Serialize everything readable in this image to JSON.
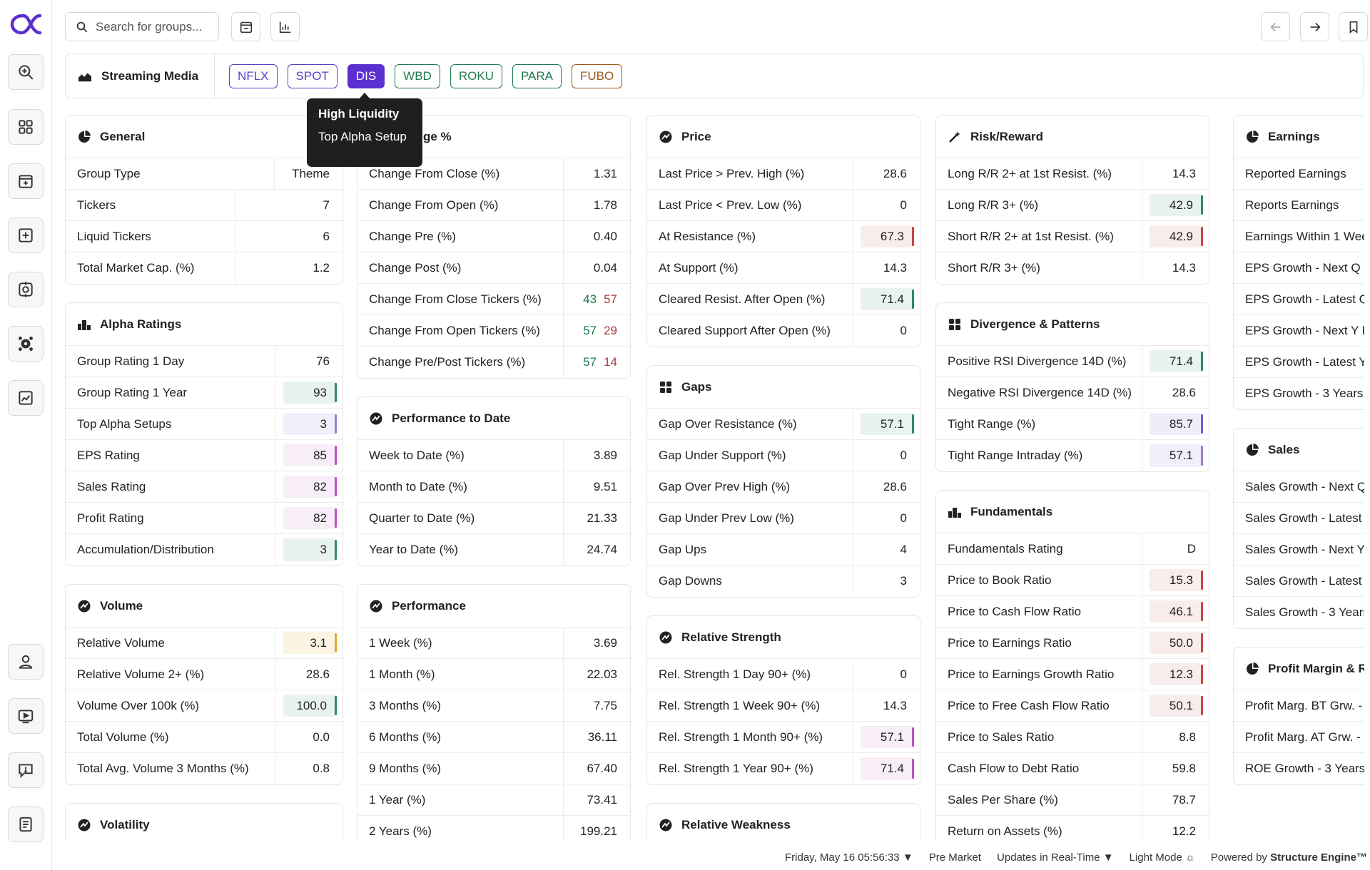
{
  "search": {
    "placeholder": "Search for groups..."
  },
  "group": {
    "name": "Streaming Media",
    "tickers": [
      {
        "label": "NFLX",
        "color": "#5b3fc4"
      },
      {
        "label": "SPOT",
        "color": "#5b3fc4"
      },
      {
        "label": "DIS",
        "color": "#ffffff",
        "active": true,
        "bg": "#5b2fd0"
      },
      {
        "label": "WBD",
        "color": "#1f7a4f"
      },
      {
        "label": "ROKU",
        "color": "#1f7a4f"
      },
      {
        "label": "PARA",
        "color": "#1f7a4f"
      },
      {
        "label": "FUBO",
        "color": "#9a5a1a"
      }
    ]
  },
  "tooltip": {
    "line1": "High Liquidity",
    "line2": "Top Alpha Setup"
  },
  "cards": {
    "general": {
      "title": "General",
      "rows": [
        {
          "label": "Group Type",
          "value": "Theme"
        },
        {
          "label": "Tickers",
          "value": "7"
        },
        {
          "label": "Liquid Tickers",
          "value": "6"
        },
        {
          "label": "Total Market Cap. (%)",
          "value": "1.2"
        }
      ]
    },
    "alpha": {
      "title": "Alpha Ratings",
      "rows": [
        {
          "label": "Group Rating 1 Day",
          "value": "76"
        },
        {
          "label": "Group Rating 1 Year",
          "value": "93"
        },
        {
          "label": "Top Alpha Setups",
          "value": "3"
        },
        {
          "label": "EPS Rating",
          "value": "85"
        },
        {
          "label": "Sales Rating",
          "value": "82"
        },
        {
          "label": "Profit Rating",
          "value": "82"
        },
        {
          "label": "Accumulation/Distribution",
          "value": "3"
        }
      ]
    },
    "volume": {
      "title": "Volume",
      "rows": [
        {
          "label": "Relative Volume",
          "value": "3.1"
        },
        {
          "label": "Relative Volume 2+ (%)",
          "value": "28.6"
        },
        {
          "label": "Volume Over 100k (%)",
          "value": "100.0"
        },
        {
          "label": "Total Volume (%)",
          "value": "0.0"
        },
        {
          "label": "Total Avg. Volume 3 Months (%)",
          "value": "0.8"
        }
      ]
    },
    "volatility": {
      "title": "Volatility"
    },
    "change": {
      "title_suffix": "ge %",
      "rows": [
        {
          "label": "Change From Close (%)",
          "value": "1.31"
        },
        {
          "label": "Change From Open (%)",
          "value": "1.78"
        },
        {
          "label": "Change Pre (%)",
          "value": "0.40"
        },
        {
          "label": "Change Post (%)",
          "value": "0.04"
        },
        {
          "label": "Change From Close Tickers (%)",
          "value_a": "43",
          "value_b": "57"
        },
        {
          "label": "Change From Open Tickers (%)",
          "value_a": "57",
          "value_b": "29"
        },
        {
          "label": "Change Pre/Post Tickers (%)",
          "value_a": "57",
          "value_b": "14"
        }
      ]
    },
    "perf_date": {
      "title": "Performance to Date",
      "rows": [
        {
          "label": "Week to Date (%)",
          "value": "3.89"
        },
        {
          "label": "Month to Date (%)",
          "value": "9.51"
        },
        {
          "label": "Quarter to Date (%)",
          "value": "21.33"
        },
        {
          "label": "Year to Date (%)",
          "value": "24.74"
        }
      ]
    },
    "performance": {
      "title": "Performance",
      "rows": [
        {
          "label": "1 Week (%)",
          "value": "3.69"
        },
        {
          "label": "1 Month (%)",
          "value": "22.03"
        },
        {
          "label": "3 Months (%)",
          "value": "7.75"
        },
        {
          "label": "6 Months (%)",
          "value": "36.11"
        },
        {
          "label": "9 Months (%)",
          "value": "67.40"
        },
        {
          "label": "1 Year (%)",
          "value": "73.41"
        },
        {
          "label": "2 Years (%)",
          "value": "199.21"
        }
      ]
    },
    "price": {
      "title": "Price",
      "rows": [
        {
          "label": "Last Price > Prev. High (%)",
          "value": "28.6"
        },
        {
          "label": "Last Price < Prev. Low (%)",
          "value": "0"
        },
        {
          "label": "At Resistance (%)",
          "value": "67.3"
        },
        {
          "label": "At Support (%)",
          "value": "14.3"
        },
        {
          "label": "Cleared Resist. After Open (%)",
          "value": "71.4"
        },
        {
          "label": "Cleared Support After Open (%)",
          "value": "0"
        }
      ]
    },
    "gaps": {
      "title": "Gaps",
      "rows": [
        {
          "label": "Gap Over Resistance (%)",
          "value": "57.1"
        },
        {
          "label": "Gap Under Support (%)",
          "value": "0"
        },
        {
          "label": "Gap Over Prev High (%)",
          "value": "28.6"
        },
        {
          "label": "Gap Under Prev Low (%)",
          "value": "0"
        },
        {
          "label": "Gap Ups",
          "value": "4"
        },
        {
          "label": "Gap Downs",
          "value": "3"
        }
      ]
    },
    "rel_strength": {
      "title": "Relative Strength",
      "rows": [
        {
          "label": "Rel. Strength 1 Day 90+ (%)",
          "value": "0"
        },
        {
          "label": "Rel. Strength 1 Week 90+ (%)",
          "value": "14.3"
        },
        {
          "label": "Rel. Strength 1 Month 90+ (%)",
          "value": "57.1"
        },
        {
          "label": "Rel. Strength 1 Year 90+ (%)",
          "value": "71.4"
        }
      ]
    },
    "rel_weakness": {
      "title": "Relative Weakness"
    },
    "risk": {
      "title": "Risk/Reward",
      "rows": [
        {
          "label": "Long R/R 2+ at 1st Resist. (%)",
          "value": "14.3"
        },
        {
          "label": "Long R/R 3+ (%)",
          "value": "42.9"
        },
        {
          "label": "Short R/R 2+ at 1st Resist. (%)",
          "value": "42.9"
        },
        {
          "label": "Short R/R 3+ (%)",
          "value": "14.3"
        }
      ]
    },
    "divergence": {
      "title": "Divergence & Patterns",
      "rows": [
        {
          "label": "Positive RSI Divergence 14D (%)",
          "value": "71.4"
        },
        {
          "label": "Negative RSI Divergence 14D (%)",
          "value": "28.6"
        },
        {
          "label": "Tight Range (%)",
          "value": "85.7"
        },
        {
          "label": "Tight Range Intraday (%)",
          "value": "57.1"
        }
      ]
    },
    "fundamentals": {
      "title": "Fundamentals",
      "rows": [
        {
          "label": "Fundamentals Rating",
          "value": "D"
        },
        {
          "label": "Price to Book Ratio",
          "value": "15.3"
        },
        {
          "label": "Price to Cash Flow Ratio",
          "value": "46.1"
        },
        {
          "label": "Price to Earnings Ratio",
          "value": "50.0"
        },
        {
          "label": "Price to Earnings Growth Ratio",
          "value": "12.3"
        },
        {
          "label": "Price to Free Cash Flow Ratio",
          "value": "50.1"
        },
        {
          "label": "Price to Sales Ratio",
          "value": "8.8"
        },
        {
          "label": "Cash Flow to Debt Ratio",
          "value": "59.8"
        },
        {
          "label": "Sales Per Share (%)",
          "value": "78.7"
        },
        {
          "label": "Return on Assets (%)",
          "value": "12.2"
        }
      ]
    },
    "earnings": {
      "title": "Earnings",
      "rows": [
        {
          "label": "Reported Earnings"
        },
        {
          "label": "Reports Earnings"
        },
        {
          "label": "Earnings Within 1 Wee"
        },
        {
          "label": "EPS Growth - Next Q F"
        },
        {
          "label": "EPS Growth - Latest Q"
        },
        {
          "label": "EPS Growth - Next Y F"
        },
        {
          "label": "EPS Growth - Latest Y"
        },
        {
          "label": "EPS Growth - 3 Years"
        }
      ]
    },
    "sales": {
      "title": "Sales",
      "rows": [
        {
          "label": "Sales Growth - Next Q"
        },
        {
          "label": "Sales Growth - Latest"
        },
        {
          "label": "Sales Growth - Next Y"
        },
        {
          "label": "Sales Growth - Latest"
        },
        {
          "label": "Sales Growth - 3 Years"
        }
      ]
    },
    "profit": {
      "title": "Profit Margin & R",
      "rows": [
        {
          "label": "Profit Marg. BT Grw. -"
        },
        {
          "label": "Profit Marg. AT Grw. -"
        },
        {
          "label": "ROE Growth - 3 Years"
        }
      ]
    }
  },
  "footer": {
    "datetime": "Friday, May 16 05:56:33",
    "session": "Pre Market",
    "updates": "Updates in Real-Time",
    "mode": "Light Mode",
    "powered_prefix": "Powered by",
    "powered_brand": "Structure Engine™"
  }
}
